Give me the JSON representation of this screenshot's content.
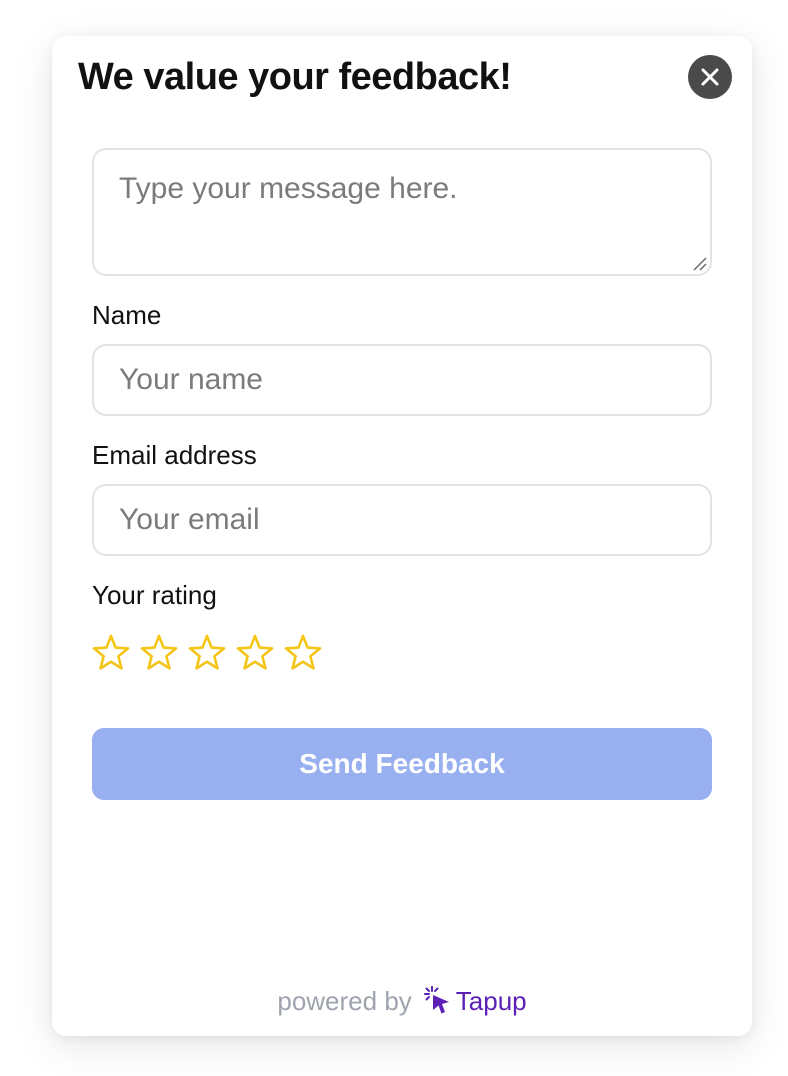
{
  "modal": {
    "title": "We value your feedback!",
    "close_icon": "close-icon"
  },
  "message": {
    "placeholder": "Type your message here.",
    "value": ""
  },
  "name_field": {
    "label": "Name",
    "placeholder": "Your name",
    "value": ""
  },
  "email_field": {
    "label": "Email address",
    "placeholder": "Your email",
    "value": ""
  },
  "rating": {
    "label": "Your rating",
    "max": 5,
    "value": 0,
    "icon": "star-outline-icon"
  },
  "submit": {
    "label": "Send Feedback"
  },
  "footer": {
    "powered_by": "powered by",
    "brand": "Tapup",
    "brand_icon": "cursor-click-icon"
  },
  "colors": {
    "title_text": "#111111",
    "close_button_bg": "#4a4a4a",
    "field_border": "#e3e3e3",
    "placeholder_text": "#7b7b7b",
    "star": "#f5c518",
    "submit_bg": "#99b0f0",
    "submit_text": "#ffffff",
    "footer_text": "#9ea3ad",
    "brand": "#5b21b6"
  }
}
